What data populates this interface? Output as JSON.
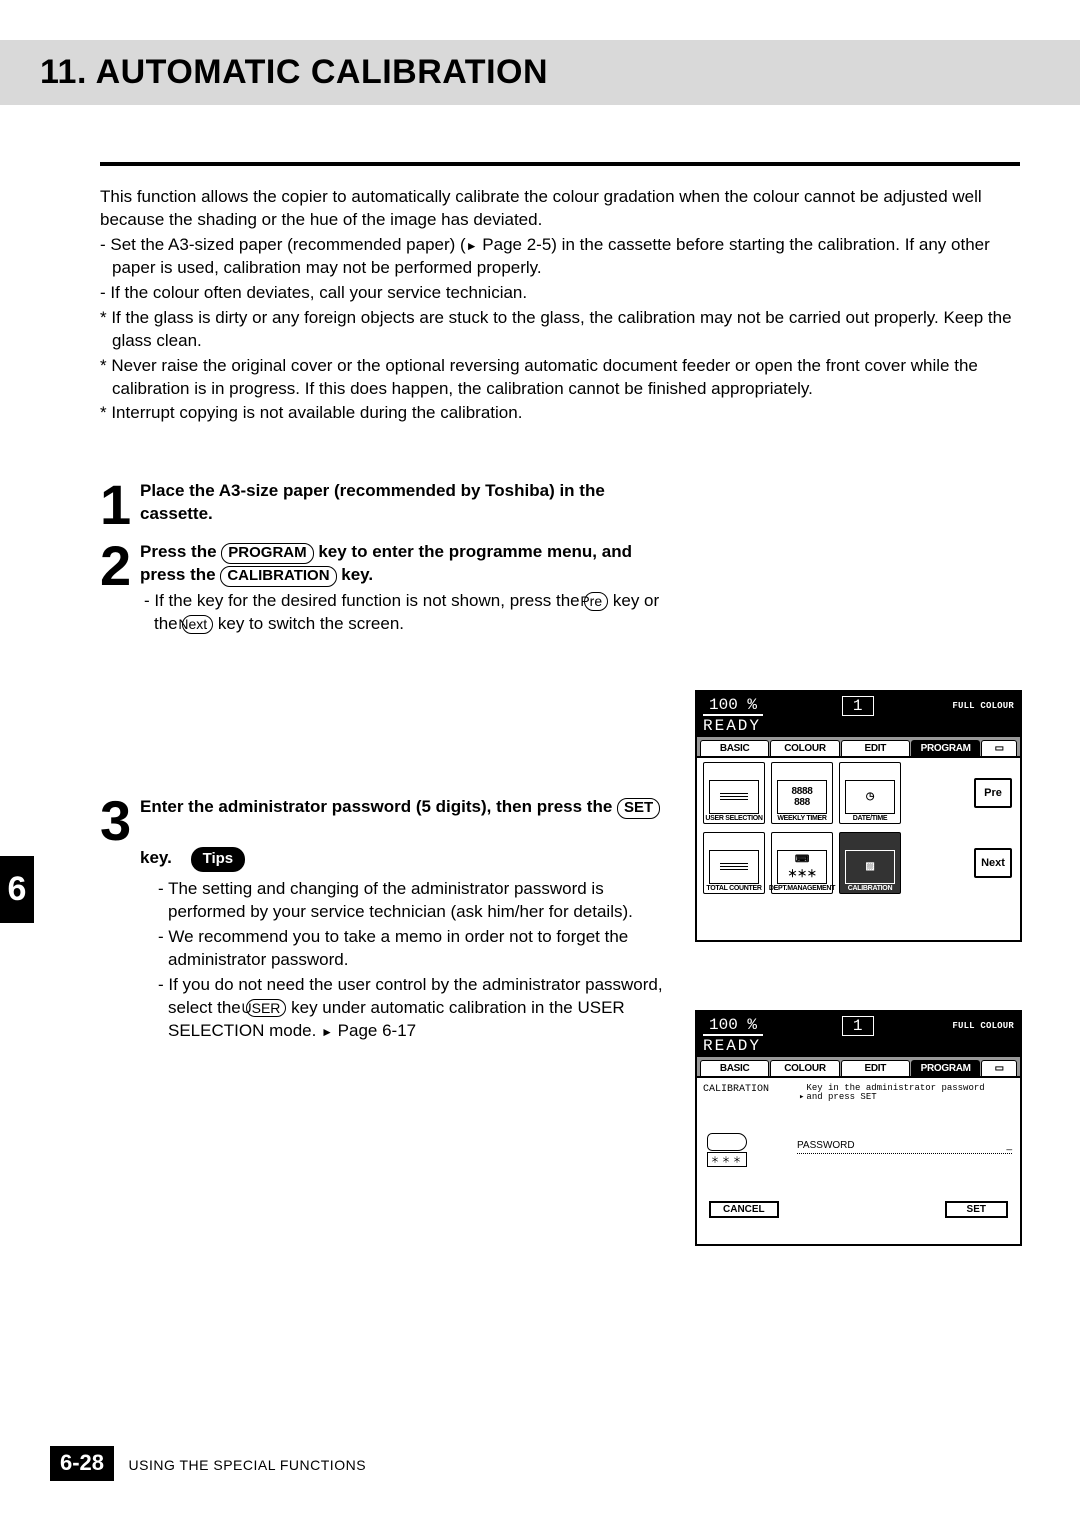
{
  "chapter": {
    "title": "11. AUTOMATIC CALIBRATION"
  },
  "intro": {
    "p1": "This function allows the copier to automatically calibrate the colour gradation when the colour cannot be adjusted well because the shading or the hue of the image has deviated.",
    "b1a": "- Set the A3-sized paper (recommended paper) (",
    "b1_ref": " Page 2-5) in the cassette before starting the calibration.  If any other paper is used, calibration may not be performed properly.",
    "b2": "- If the colour often deviates, call your service technician.",
    "n1": "* If the glass is dirty or any foreign objects are stuck to the glass, the calibration may not be carried out properly.  Keep the glass clean.",
    "n2": "* Never raise the original cover or the optional  reversing automatic document feeder or open the front cover while the calibration is in progress.  If this does happen, the calibration cannot be finished appropriately.",
    "n3": "* Interrupt copying is not available during the calibration."
  },
  "steps": {
    "s1": {
      "num": "1",
      "text": "Place the A3-size paper (recommended by Toshiba) in the cassette."
    },
    "s2": {
      "num": "2",
      "t1": "Press the ",
      "k1": "PROGRAM",
      "t2": " key to enter the programme menu,  and press the ",
      "k2": "CALIBRATION",
      "t3": " key.",
      "sub1a": "- If the key for the desired function is not shown, press the ",
      "sub1_k1": "Pre",
      "sub1b": " key or the ",
      "sub1_k2": "Next",
      "sub1c": " key to switch the screen."
    },
    "s3": {
      "num": "3",
      "t1": "Enter the administrator password (5 digits), then press the ",
      "k1": "SET",
      "t2": " key."
    }
  },
  "tips": {
    "label": "Tips",
    "t1": "- The setting and changing of the administrator password is performed by your service technician (ask him/her for details).",
    "t2": "- We recommend you to take a memo in order not to forget the administrator password.",
    "t3a": "- If you do not need the user control by the administrator password, select the ",
    "t3_k": "USER",
    "t3b": " key under automatic calibration in the USER SELECTION mode. ",
    "t3_ref": " Page 6-17"
  },
  "sidetab": "6",
  "footer": {
    "page": "6-28",
    "text": "USING THE SPECIAL FUNCTIONS"
  },
  "screen1": {
    "zoom": "100  %",
    "copies": "1",
    "fc": "FULL COLOUR",
    "ready": "READY",
    "tabs": [
      "BASIC",
      "COLOUR",
      "EDIT",
      "PROGRAM"
    ],
    "buttons": {
      "user_selection": "USER SELECTION",
      "weekly_timer": "WEEKLY TIMER",
      "date_time": "DATE/TIME",
      "total_counter": "TOTAL COUNTER",
      "dept_management": "DEPT.MANAGEMENT",
      "calibration": "CALIBRATION",
      "pre": "Pre",
      "next": "Next"
    }
  },
  "screen2": {
    "zoom": "100  %",
    "copies": "1",
    "fc": "FULL COLOUR",
    "ready": "READY",
    "tabs": [
      "BASIC",
      "COLOUR",
      "EDIT",
      "PROGRAM"
    ],
    "title": "CALIBRATION",
    "prompt": "Key in the administrator password and press SET",
    "kb": "＊＊＊",
    "pw_label": "PASSWORD",
    "pw_value": "_",
    "cancel": "CANCEL",
    "set": "SET"
  }
}
